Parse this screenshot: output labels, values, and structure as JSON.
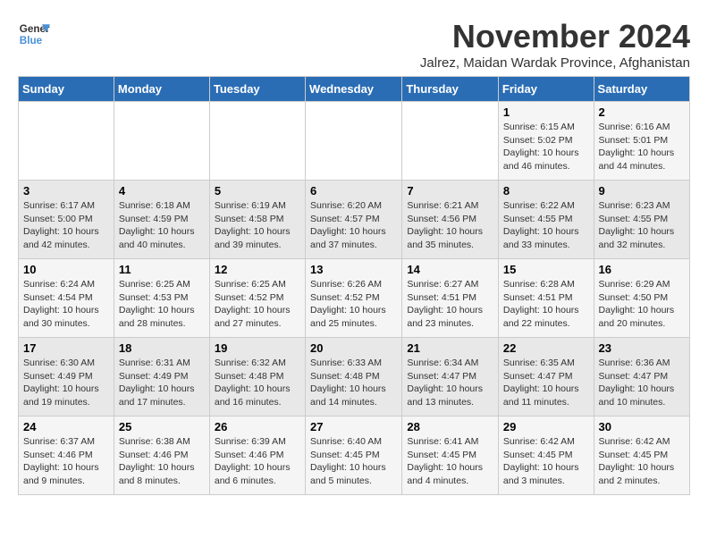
{
  "logo": {
    "line1": "General",
    "line2": "Blue"
  },
  "title": "November 2024",
  "subtitle": "Jalrez, Maidan Wardak Province, Afghanistan",
  "days_header": [
    "Sunday",
    "Monday",
    "Tuesday",
    "Wednesday",
    "Thursday",
    "Friday",
    "Saturday"
  ],
  "weeks": [
    [
      {
        "day": "",
        "info": ""
      },
      {
        "day": "",
        "info": ""
      },
      {
        "day": "",
        "info": ""
      },
      {
        "day": "",
        "info": ""
      },
      {
        "day": "",
        "info": ""
      },
      {
        "day": "1",
        "info": "Sunrise: 6:15 AM\nSunset: 5:02 PM\nDaylight: 10 hours\nand 46 minutes."
      },
      {
        "day": "2",
        "info": "Sunrise: 6:16 AM\nSunset: 5:01 PM\nDaylight: 10 hours\nand 44 minutes."
      }
    ],
    [
      {
        "day": "3",
        "info": "Sunrise: 6:17 AM\nSunset: 5:00 PM\nDaylight: 10 hours\nand 42 minutes."
      },
      {
        "day": "4",
        "info": "Sunrise: 6:18 AM\nSunset: 4:59 PM\nDaylight: 10 hours\nand 40 minutes."
      },
      {
        "day": "5",
        "info": "Sunrise: 6:19 AM\nSunset: 4:58 PM\nDaylight: 10 hours\nand 39 minutes."
      },
      {
        "day": "6",
        "info": "Sunrise: 6:20 AM\nSunset: 4:57 PM\nDaylight: 10 hours\nand 37 minutes."
      },
      {
        "day": "7",
        "info": "Sunrise: 6:21 AM\nSunset: 4:56 PM\nDaylight: 10 hours\nand 35 minutes."
      },
      {
        "day": "8",
        "info": "Sunrise: 6:22 AM\nSunset: 4:55 PM\nDaylight: 10 hours\nand 33 minutes."
      },
      {
        "day": "9",
        "info": "Sunrise: 6:23 AM\nSunset: 4:55 PM\nDaylight: 10 hours\nand 32 minutes."
      }
    ],
    [
      {
        "day": "10",
        "info": "Sunrise: 6:24 AM\nSunset: 4:54 PM\nDaylight: 10 hours\nand 30 minutes."
      },
      {
        "day": "11",
        "info": "Sunrise: 6:25 AM\nSunset: 4:53 PM\nDaylight: 10 hours\nand 28 minutes."
      },
      {
        "day": "12",
        "info": "Sunrise: 6:25 AM\nSunset: 4:52 PM\nDaylight: 10 hours\nand 27 minutes."
      },
      {
        "day": "13",
        "info": "Sunrise: 6:26 AM\nSunset: 4:52 PM\nDaylight: 10 hours\nand 25 minutes."
      },
      {
        "day": "14",
        "info": "Sunrise: 6:27 AM\nSunset: 4:51 PM\nDaylight: 10 hours\nand 23 minutes."
      },
      {
        "day": "15",
        "info": "Sunrise: 6:28 AM\nSunset: 4:51 PM\nDaylight: 10 hours\nand 22 minutes."
      },
      {
        "day": "16",
        "info": "Sunrise: 6:29 AM\nSunset: 4:50 PM\nDaylight: 10 hours\nand 20 minutes."
      }
    ],
    [
      {
        "day": "17",
        "info": "Sunrise: 6:30 AM\nSunset: 4:49 PM\nDaylight: 10 hours\nand 19 minutes."
      },
      {
        "day": "18",
        "info": "Sunrise: 6:31 AM\nSunset: 4:49 PM\nDaylight: 10 hours\nand 17 minutes."
      },
      {
        "day": "19",
        "info": "Sunrise: 6:32 AM\nSunset: 4:48 PM\nDaylight: 10 hours\nand 16 minutes."
      },
      {
        "day": "20",
        "info": "Sunrise: 6:33 AM\nSunset: 4:48 PM\nDaylight: 10 hours\nand 14 minutes."
      },
      {
        "day": "21",
        "info": "Sunrise: 6:34 AM\nSunset: 4:47 PM\nDaylight: 10 hours\nand 13 minutes."
      },
      {
        "day": "22",
        "info": "Sunrise: 6:35 AM\nSunset: 4:47 PM\nDaylight: 10 hours\nand 11 minutes."
      },
      {
        "day": "23",
        "info": "Sunrise: 6:36 AM\nSunset: 4:47 PM\nDaylight: 10 hours\nand 10 minutes."
      }
    ],
    [
      {
        "day": "24",
        "info": "Sunrise: 6:37 AM\nSunset: 4:46 PM\nDaylight: 10 hours\nand 9 minutes."
      },
      {
        "day": "25",
        "info": "Sunrise: 6:38 AM\nSunset: 4:46 PM\nDaylight: 10 hours\nand 8 minutes."
      },
      {
        "day": "26",
        "info": "Sunrise: 6:39 AM\nSunset: 4:46 PM\nDaylight: 10 hours\nand 6 minutes."
      },
      {
        "day": "27",
        "info": "Sunrise: 6:40 AM\nSunset: 4:45 PM\nDaylight: 10 hours\nand 5 minutes."
      },
      {
        "day": "28",
        "info": "Sunrise: 6:41 AM\nSunset: 4:45 PM\nDaylight: 10 hours\nand 4 minutes."
      },
      {
        "day": "29",
        "info": "Sunrise: 6:42 AM\nSunset: 4:45 PM\nDaylight: 10 hours\nand 3 minutes."
      },
      {
        "day": "30",
        "info": "Sunrise: 6:42 AM\nSunset: 4:45 PM\nDaylight: 10 hours\nand 2 minutes."
      }
    ]
  ]
}
